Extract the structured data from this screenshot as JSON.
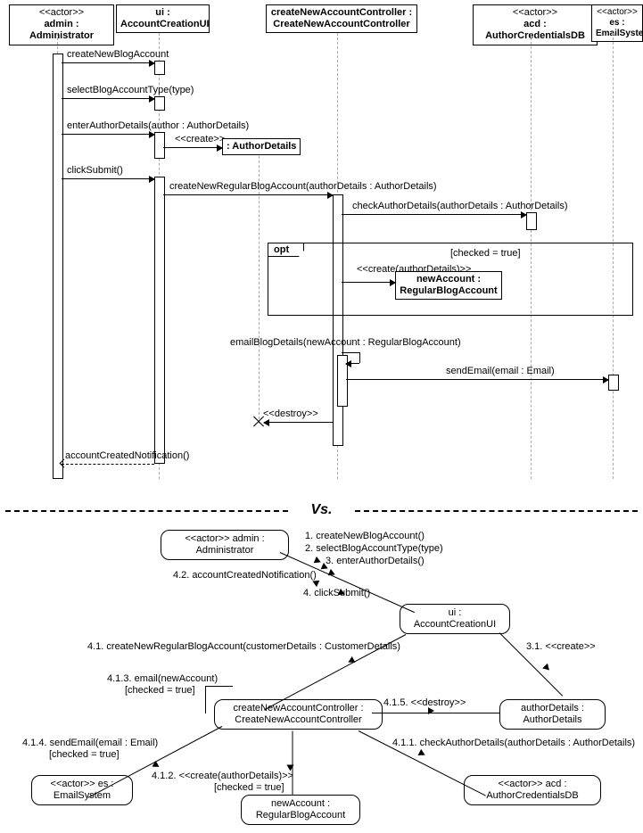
{
  "participants": {
    "admin": {
      "stereo": "<<actor>>",
      "name": "admin : Administrator"
    },
    "ui": {
      "stereo": "",
      "name": "ui :\nAccountCreationUI"
    },
    "ctrl": {
      "stereo": "",
      "name": "createNewAccountController :\nCreateNewAccountController"
    },
    "acd": {
      "stereo": "<<actor>>",
      "name": "acd : AuthorCredentialsDB"
    },
    "es": {
      "stereo": "<<actor>>",
      "name": "es : EmailSystem"
    },
    "ad": {
      "stereo": "",
      "name": ": AuthorDetails"
    },
    "acct": {
      "stereo": "",
      "name": "newAccount :\nRegularBlogAccount"
    }
  },
  "seq": {
    "m1": "createNewBlogAccount",
    "m2": "selectBlogAccountType(type)",
    "m3": "enterAuthorDetails(author : AuthorDetails)",
    "m4": "<<create>>",
    "m5": "clickSubmit()",
    "m6": "createNewRegularBlogAccount(authorDetails : AuthorDetails)",
    "m7": "checkAuthorDetails(authorDetails : AuthorDetails)",
    "opt": "opt",
    "guard": "[checked = true]",
    "m8": "<<create(authorDetails)>>",
    "m9": "emailBlogDetails(newAccount : RegularBlogAccount)",
    "m10": "sendEmail(email : Email)",
    "m11": "<<destroy>>",
    "m12": "accountCreatedNotification()"
  },
  "vs": "Vs.",
  "comm": {
    "admin": {
      "stereo": "<<actor>>",
      "name": "admin : Administrator"
    },
    "ui": {
      "stereo": "",
      "name": "ui :\nAccountCreationUI"
    },
    "ctrl": {
      "stereo": "",
      "name": "createNewAccountController :\nCreateNewAccountController"
    },
    "ad": {
      "stereo": "",
      "name": "authorDetails :\nAuthorDetails"
    },
    "acd": {
      "stereo": "<<actor>>",
      "name": "acd : AuthorCredentialsDB"
    },
    "es": {
      "stereo": "<<actor>>",
      "name": "es : EmailSystem"
    },
    "acct": {
      "stereo": "",
      "name": "newAccount :\nRegularBlogAccount"
    },
    "l1": "1. createNewBlogAccount()",
    "l2": "2. selectBlogAccountType(type)",
    "l3": "3. enterAuthorDetails()",
    "l4": "4. clickSubmit()",
    "l42": "4.2. accountCreatedNotification()",
    "l31": "3.1. <<create>>",
    "l41": "4.1. createNewRegularBlogAccount(customerDetails : CustomerDetails)",
    "l413": "4.1.3. email(newAccount)",
    "l413g": "[checked = true]",
    "l411": "4.1.1. checkAuthorDetails(authorDetails : AuthorDetails)",
    "l412": "4.1.2. <<create(authorDetails)>>",
    "l412g": "[checked = true]",
    "l414": "4.1.4. sendEmail(email : Email)",
    "l414g": "[checked = true]",
    "l415": "4.1.5. <<destroy>>"
  },
  "chart_data": {
    "type": "uml",
    "diagrams": [
      "sequence",
      "communication"
    ],
    "sequence": {
      "participants": [
        {
          "id": "admin",
          "stereotype": "actor",
          "label": "admin : Administrator"
        },
        {
          "id": "ui",
          "label": "ui : AccountCreationUI"
        },
        {
          "id": "ctrl",
          "label": "createNewAccountController : CreateNewAccountController"
        },
        {
          "id": "acd",
          "stereotype": "actor",
          "label": "acd : AuthorCredentialsDB"
        },
        {
          "id": "es",
          "stereotype": "actor",
          "label": "es : EmailSystem"
        }
      ],
      "created": [
        {
          "id": "ad",
          "label": ": AuthorDetails"
        },
        {
          "id": "acct",
          "label": "newAccount : RegularBlogAccount"
        }
      ],
      "messages": [
        {
          "from": "admin",
          "to": "ui",
          "label": "createNewBlogAccount",
          "kind": "sync"
        },
        {
          "from": "admin",
          "to": "ui",
          "label": "selectBlogAccountType(type)",
          "kind": "sync"
        },
        {
          "from": "admin",
          "to": "ui",
          "label": "enterAuthorDetails(author : AuthorDetails)",
          "kind": "sync"
        },
        {
          "from": "ui",
          "to": "ad",
          "label": "<<create>>",
          "kind": "create"
        },
        {
          "from": "admin",
          "to": "ui",
          "label": "clickSubmit()",
          "kind": "sync"
        },
        {
          "from": "ui",
          "to": "ctrl",
          "label": "createNewRegularBlogAccount(authorDetails : AuthorDetails)",
          "kind": "sync"
        },
        {
          "from": "ctrl",
          "to": "acd",
          "label": "checkAuthorDetails(authorDetails : AuthorDetails)",
          "kind": "sync"
        },
        {
          "frame": "opt",
          "guard": "[checked = true]",
          "messages": [
            {
              "from": "ctrl",
              "to": "acct",
              "label": "<<create(authorDetails)>>",
              "kind": "create"
            }
          ]
        },
        {
          "from": "ctrl",
          "to": "ctrl",
          "label": "emailBlogDetails(newAccount : RegularBlogAccount)",
          "kind": "self"
        },
        {
          "from": "ctrl",
          "to": "es",
          "label": "sendEmail(email : Email)",
          "kind": "sync"
        },
        {
          "from": "ctrl",
          "to": "ad",
          "label": "<<destroy>>",
          "kind": "destroy"
        },
        {
          "from": "ui",
          "to": "admin",
          "label": "accountCreatedNotification()",
          "kind": "return"
        }
      ]
    },
    "communication": {
      "objects": [
        {
          "id": "admin",
          "stereotype": "actor",
          "label": "admin : Administrator"
        },
        {
          "id": "ui",
          "label": "ui : AccountCreationUI"
        },
        {
          "id": "ctrl",
          "label": "createNewAccountController : CreateNewAccountController"
        },
        {
          "id": "ad",
          "label": "authorDetails : AuthorDetails"
        },
        {
          "id": "acd",
          "stereotype": "actor",
          "label": "acd : AuthorCredentialsDB"
        },
        {
          "id": "es",
          "stereotype": "actor",
          "label": "es : EmailSystem"
        },
        {
          "id": "acct",
          "label": "newAccount : RegularBlogAccount"
        }
      ],
      "links": [
        {
          "between": [
            "admin",
            "ui"
          ],
          "messages": [
            {
              "seq": "1",
              "label": "createNewBlogAccount()",
              "dir": "to-ui"
            },
            {
              "seq": "2",
              "label": "selectBlogAccountType(type)",
              "dir": "to-ui"
            },
            {
              "seq": "3",
              "label": "enterAuthorDetails()",
              "dir": "to-ui"
            },
            {
              "seq": "4",
              "label": "clickSubmit()",
              "dir": "to-ui"
            },
            {
              "seq": "4.2",
              "label": "accountCreatedNotification()",
              "dir": "to-admin"
            }
          ]
        },
        {
          "between": [
            "ui",
            "ad"
          ],
          "messages": [
            {
              "seq": "3.1",
              "label": "<<create>>",
              "dir": "to-ad"
            }
          ]
        },
        {
          "between": [
            "ui",
            "ctrl"
          ],
          "messages": [
            {
              "seq": "4.1",
              "label": "createNewRegularBlogAccount(customerDetails : CustomerDetails)",
              "dir": "to-ctrl"
            }
          ]
        },
        {
          "between": [
            "ctrl",
            "ctrl"
          ],
          "messages": [
            {
              "seq": "4.1.3",
              "label": "email(newAccount)",
              "guard": "[checked = true]",
              "dir": "self"
            }
          ]
        },
        {
          "between": [
            "ctrl",
            "acd"
          ],
          "messages": [
            {
              "seq": "4.1.1",
              "label": "checkAuthorDetails(authorDetails : AuthorDetails)",
              "dir": "to-acd"
            }
          ]
        },
        {
          "between": [
            "ctrl",
            "acct"
          ],
          "messages": [
            {
              "seq": "4.1.2",
              "label": "<<create(authorDetails)>>",
              "guard": "[checked = true]",
              "dir": "to-acct"
            }
          ]
        },
        {
          "between": [
            "ctrl",
            "es"
          ],
          "messages": [
            {
              "seq": "4.1.4",
              "label": "sendEmail(email : Email)",
              "guard": "[checked = true]",
              "dir": "to-es"
            }
          ]
        },
        {
          "between": [
            "ctrl",
            "ad"
          ],
          "messages": [
            {
              "seq": "4.1.5",
              "label": "<<destroy>>",
              "dir": "to-ad"
            }
          ]
        }
      ]
    }
  }
}
